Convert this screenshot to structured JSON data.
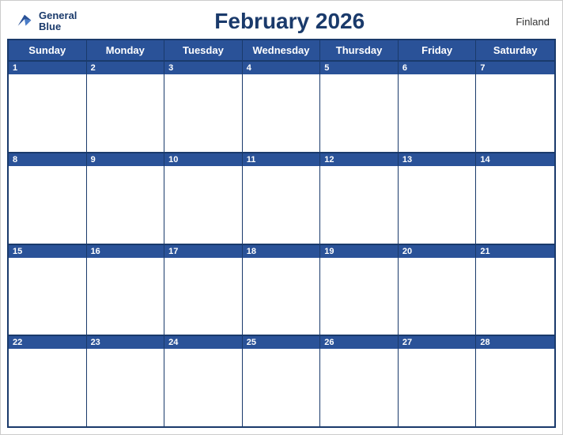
{
  "header": {
    "logo_text_general": "General",
    "logo_text_blue": "Blue",
    "title": "February 2026",
    "country": "Finland"
  },
  "days_of_week": [
    "Sunday",
    "Monday",
    "Tuesday",
    "Wednesday",
    "Thursday",
    "Friday",
    "Saturday"
  ],
  "weeks": [
    [
      1,
      2,
      3,
      4,
      5,
      6,
      7
    ],
    [
      8,
      9,
      10,
      11,
      12,
      13,
      14
    ],
    [
      15,
      16,
      17,
      18,
      19,
      20,
      21
    ],
    [
      22,
      23,
      24,
      25,
      26,
      27,
      28
    ]
  ]
}
